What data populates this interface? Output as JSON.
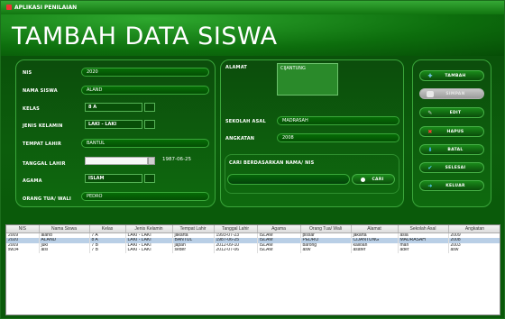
{
  "window": {
    "title": "APLIKASI PENILAIAN"
  },
  "header": {
    "title": "TAMBAH DATA SISWA"
  },
  "form": {
    "nis": {
      "label": "NIS",
      "value": "2020"
    },
    "nama": {
      "label": "NAMA SISWA",
      "value": "ALAND"
    },
    "kelas": {
      "label": "KELAS",
      "value": "8 A"
    },
    "jenis_kelamin": {
      "label": "JENIS KELAMIN",
      "value": "LAKI - LAKI"
    },
    "tempat_lahir": {
      "label": "TEMPAT LAHIR",
      "value": "BANTUL"
    },
    "tanggal_lahir": {
      "label": "TANGGAL LAHIR",
      "value": "1987-06-25"
    },
    "agama": {
      "label": "AGAMA",
      "value": "ISLAM"
    },
    "orang_tua": {
      "label": "ORANG TUA/ WALI",
      "value": "PEDRO"
    },
    "alamat": {
      "label": "ALAMAT",
      "value": "CIJANTUNG"
    },
    "sekolah_asal": {
      "label": "SEKOLAH ASAL",
      "value": "MADRASAH"
    },
    "angkatan": {
      "label": "ANGKATAN",
      "value": "2008"
    },
    "search": {
      "label": "CARI BERDASARKAN NAMA/ NIS",
      "button": "CARI"
    }
  },
  "actions": {
    "tambah": "TAMBAH",
    "simpan": "SIMPAN",
    "edit": "EDIT",
    "hapus": "HAPUS",
    "batal": "BATAL",
    "selesai": "SELESAI",
    "keluar": "KELUAR"
  },
  "table": {
    "columns": [
      "NIS",
      "Nama Siswa",
      "Kelas",
      "Jenis Kelamin",
      "Tempat Lahir",
      "Tanggal Lahir",
      "Agama",
      "Orang Tua/ Wali",
      "Alamat",
      "Sekolah Asal",
      "Angkatan"
    ],
    "rows": [
      [
        "2009",
        "aland",
        "7 A",
        "LAKI - LAKI",
        "jakarta",
        "1993-07-23",
        "ISLAM",
        "pissar",
        "jakarta",
        "asia",
        "2009"
      ],
      [
        "2020",
        "ALAND",
        "8 A",
        "LAKI - LAKI",
        "BANTUL",
        "1987-06-25",
        "ISLAM",
        "PEDRO",
        "CIJANTUNG",
        "MADRASAH",
        "2008"
      ],
      [
        "2009",
        "juki",
        "7 B",
        "LAKI - LAKI",
        "japan",
        "2012-09-10",
        "ISLAM",
        "barong",
        "kalioan",
        "man",
        "2003"
      ],
      [
        "sw34",
        "aisi",
        "7 B",
        "LAKI - LAKI",
        "seder",
        "2012-07-06",
        "ISLAM",
        "asw",
        "asafer",
        "ader",
        "asw"
      ]
    ]
  }
}
